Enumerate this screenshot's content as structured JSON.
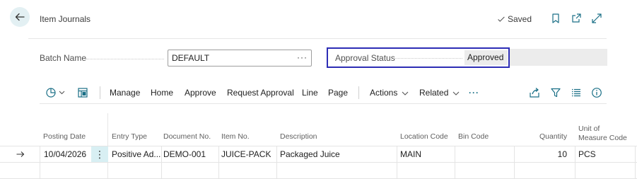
{
  "header": {
    "title": "Item Journals",
    "saved_label": "Saved"
  },
  "fields": {
    "batch_name_label": "Batch Name",
    "batch_name_value": "DEFAULT",
    "lookup_glyph": "···",
    "approval_status_label": "Approval Status",
    "approval_status_value": "Approved"
  },
  "toolbar": {
    "actions": [
      "Manage",
      "Home",
      "Approve",
      "Request Approval",
      "Line",
      "Page"
    ],
    "actions_menu": "Actions",
    "related_menu": "Related",
    "more_glyph": "···",
    "icons": [
      "analysis-icon",
      "edit-list-icon",
      "share-icon",
      "filter-icon",
      "list-view-icon",
      "info-icon"
    ]
  },
  "grid": {
    "columns": [
      "Posting Date",
      "Entry Type",
      "Document No.",
      "Item No.",
      "Description",
      "Location Code",
      "Bin Code",
      "Quantity",
      "Unit of",
      "Measure Code"
    ],
    "rows": [
      {
        "posting_date": "10/04/2026",
        "entry_type": "Positive Ad...",
        "document_no": "DEMO-001",
        "item_no": "JUICE-PACK",
        "description": "Packaged Juice",
        "location_code": "MAIN",
        "bin_code": "",
        "quantity": "10",
        "uom": "PCS"
      }
    ],
    "row_menu_glyph": "⋮"
  },
  "colors": {
    "accent": "#2d2db5",
    "back_bg": "#e3f0f3",
    "selected_cell": "#d8eff3",
    "icon_teal": "#1a6f86"
  }
}
